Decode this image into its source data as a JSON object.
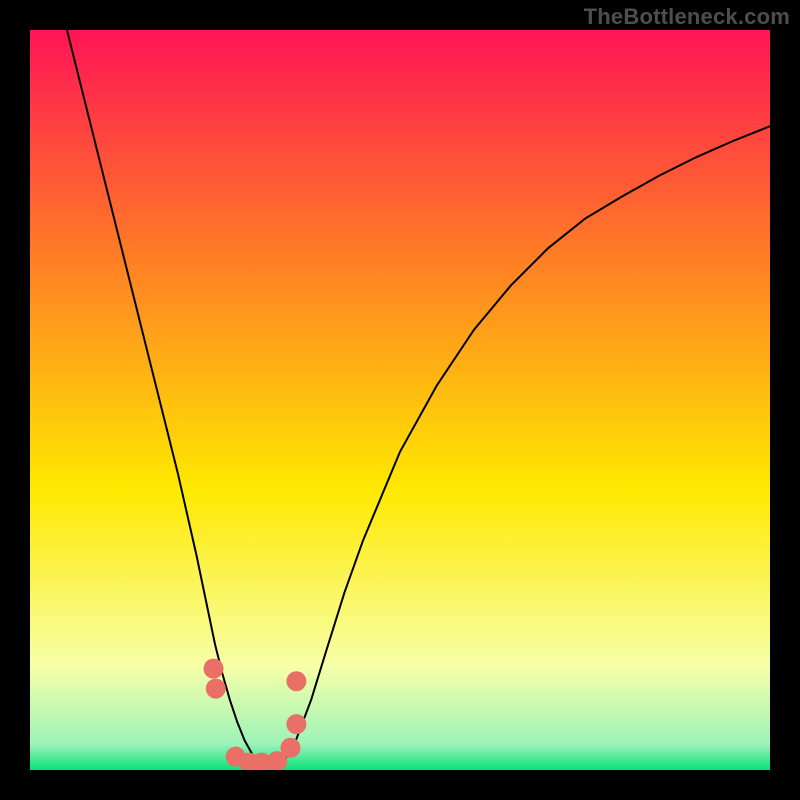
{
  "watermark": "TheBottleneck.com",
  "chart_data": {
    "type": "line",
    "title": "",
    "xlabel": "",
    "ylabel": "",
    "xlim": [
      0,
      1
    ],
    "ylim": [
      0,
      1
    ],
    "background_gradient": {
      "top": "#ff1455",
      "upper_mid": "#ff7b26",
      "mid": "#ffe900",
      "lower": "#f7ffa8",
      "bottom": "#08e27a"
    },
    "series": [
      {
        "name": "curve",
        "stroke": "#000000",
        "stroke_width": 2,
        "x": [
          0.05,
          0.075,
          0.1,
          0.125,
          0.15,
          0.175,
          0.2,
          0.225,
          0.25,
          0.26,
          0.27,
          0.28,
          0.29,
          0.3,
          0.31,
          0.32,
          0.33,
          0.34,
          0.35,
          0.36,
          0.38,
          0.4,
          0.425,
          0.45,
          0.5,
          0.55,
          0.6,
          0.65,
          0.7,
          0.75,
          0.8,
          0.85,
          0.9,
          0.95,
          1.0
        ],
        "y": [
          1.0,
          0.9,
          0.8,
          0.7,
          0.6,
          0.5,
          0.4,
          0.29,
          0.17,
          0.13,
          0.095,
          0.065,
          0.04,
          0.022,
          0.01,
          0.005,
          0.005,
          0.01,
          0.022,
          0.042,
          0.095,
          0.16,
          0.24,
          0.31,
          0.43,
          0.52,
          0.595,
          0.655,
          0.705,
          0.745,
          0.775,
          0.803,
          0.828,
          0.85,
          0.87
        ]
      }
    ],
    "markers": {
      "name": "highlight-dots",
      "fill": "#e96f67",
      "radius": 10,
      "x": [
        0.248,
        0.251,
        0.278,
        0.296,
        0.313,
        0.334,
        0.352,
        0.36,
        0.36
      ],
      "y": [
        0.137,
        0.11,
        0.018,
        0.01,
        0.01,
        0.012,
        0.03,
        0.062,
        0.12
      ]
    }
  }
}
